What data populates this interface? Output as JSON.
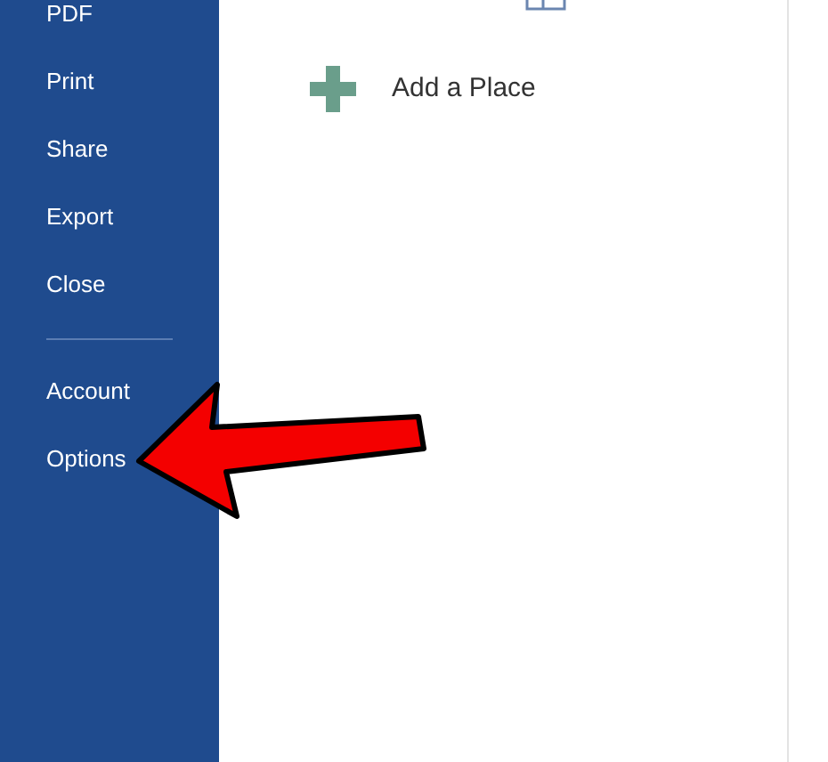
{
  "sidebar": {
    "groups": [
      {
        "items": [
          "PDF",
          "Print",
          "Share",
          "Export",
          "Close"
        ]
      },
      {
        "items": [
          "Account",
          "Options"
        ]
      }
    ]
  },
  "places": [
    {
      "kind": "add",
      "label": "Add a Place"
    }
  ]
}
